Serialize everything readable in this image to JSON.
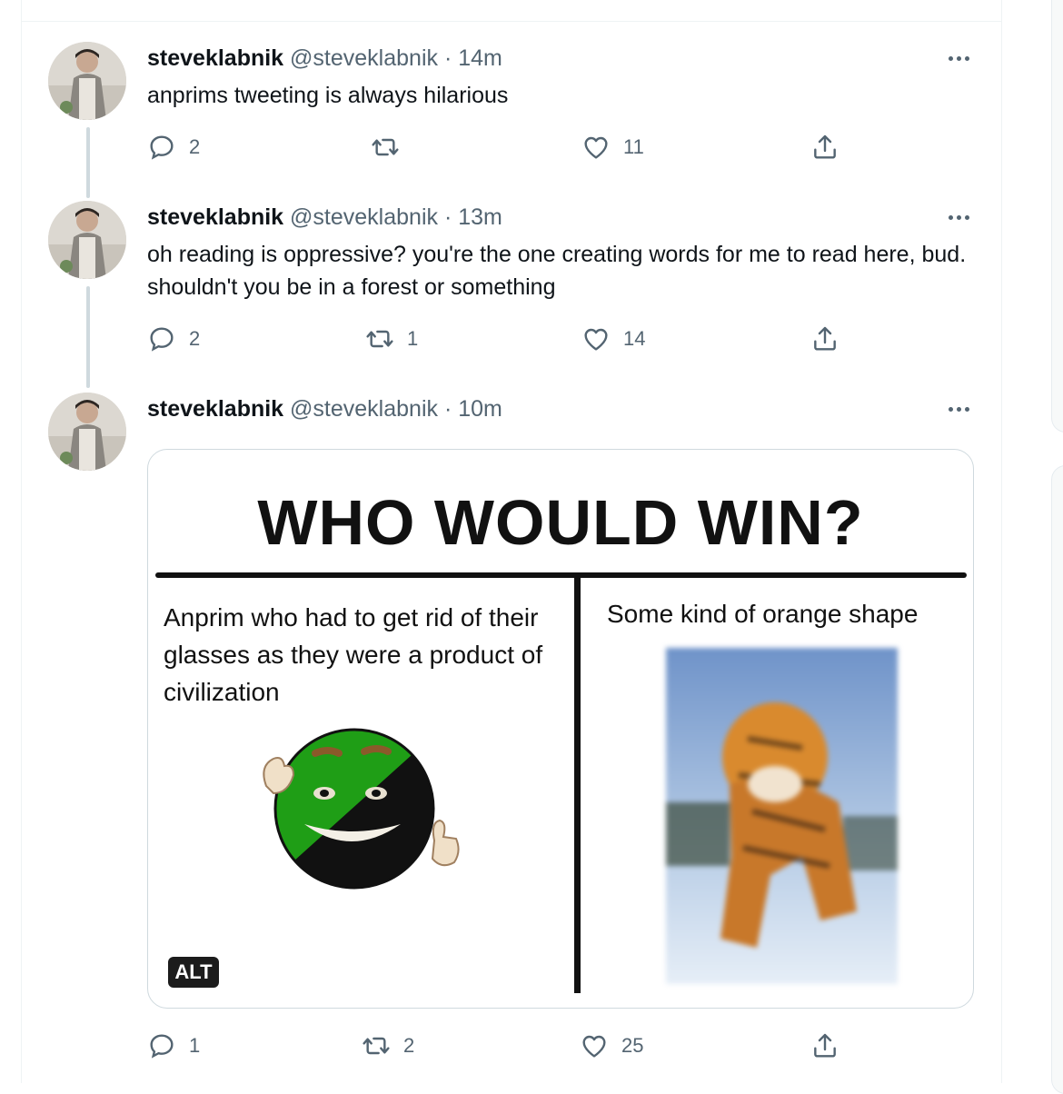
{
  "tweets": [
    {
      "name": "steveklabnik",
      "handle": "@steveklabnik",
      "time": "· 14m",
      "text": "anprims tweeting is always hilarious",
      "replies": "2",
      "retweets": "",
      "likes": "11"
    },
    {
      "name": "steveklabnik",
      "handle": "@steveklabnik",
      "time": "· 13m",
      "text": "oh reading is oppressive? you're the one creating words for me to read here, bud. shouldn't you be in a forest or something",
      "replies": "2",
      "retweets": "1",
      "likes": "14"
    },
    {
      "name": "steveklabnik",
      "handle": "@steveklabnik",
      "time": "· 10m",
      "text": "",
      "replies": "1",
      "retweets": "2",
      "likes": "25",
      "media": {
        "title": "WHO WOULD WIN?",
        "left_caption": "Anprim who had to get rid of their glasses as they were a product of civilization",
        "right_caption": "Some kind of orange shape",
        "alt_badge": "ALT"
      }
    }
  ],
  "icons": [
    "reply-icon",
    "retweet-icon",
    "like-icon",
    "share-icon",
    "more-icon"
  ],
  "colors": {
    "text": "#0f1419",
    "secondary": "#536471",
    "border": "#eff3f4",
    "thread_line": "#cfd9de",
    "anarchist_green": "#1f9e16"
  }
}
